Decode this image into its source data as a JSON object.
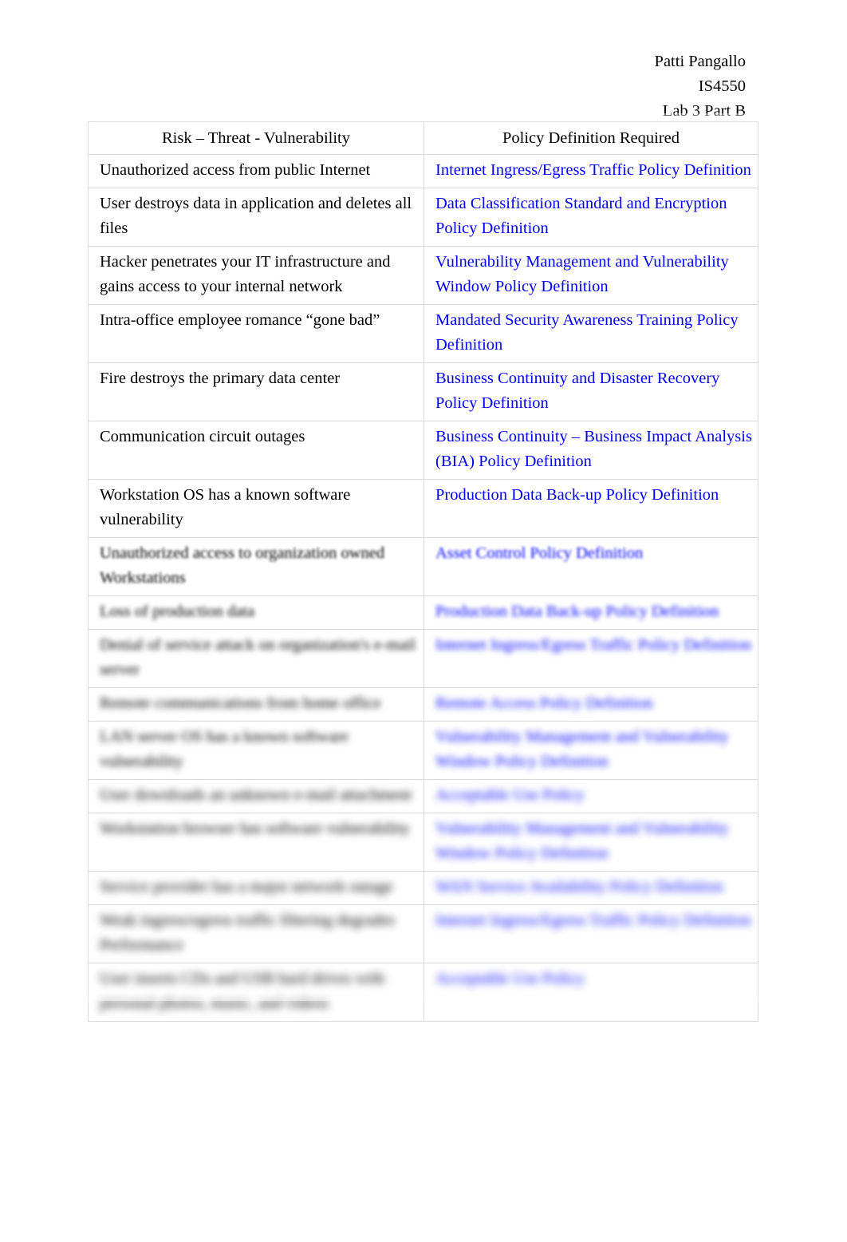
{
  "header": {
    "student_name": "Patti Pangallo",
    "course_code": "IS4550",
    "assignment": "Lab 3 Part B"
  },
  "table": {
    "columns": [
      "Risk – Threat - Vulnerability",
      "Policy Definition Required"
    ],
    "accent_color": "#0000ff",
    "rows": [
      {
        "risk": "Unauthorized access from public Internet",
        "policy": "Internet Ingress/Egress Traffic Policy Definition"
      },
      {
        "risk": "User destroys data in application and deletes all files",
        "policy": "Data Classification Standard and Encryption Policy Definition"
      },
      {
        "risk": "Hacker penetrates your IT infrastructure and gains access to your internal network",
        "policy": "Vulnerability Management and Vulnerability Window Policy Definition"
      },
      {
        "risk": "Intra-office employee romance “gone bad”",
        "policy": "Mandated Security Awareness Training Policy Definition"
      },
      {
        "risk": "Fire destroys the primary data center",
        "policy": "Business Continuity and Disaster Recovery Policy Definition"
      },
      {
        "risk": "Communication circuit outages",
        "policy": "Business Continuity – Business Impact Analysis (BIA) Policy Definition"
      },
      {
        "risk": "Workstation OS has a known software vulnerability",
        "policy": "Production Data Back-up Policy Definition"
      },
      {
        "risk": "Unauthorized access to organization owned Workstations",
        "policy": "Asset Control Policy Definition"
      },
      {
        "risk": "Loss of production data",
        "policy": "Production Data Back-up Policy Definition"
      },
      {
        "risk": "Denial of service attack on organization's e-mail server",
        "policy": "Internet Ingress/Egress Traffic Policy Definition"
      },
      {
        "risk": "Remote communications from home office",
        "policy": "Remote Access Policy Definition"
      },
      {
        "risk": "LAN server OS has a known software vulnerability",
        "policy": "Vulnerability Management and Vulnerability Window Policy Definition"
      },
      {
        "risk": "User downloads an unknown e-mail attachment",
        "policy": "Acceptable Use Policy"
      },
      {
        "risk": "Workstation browser has software vulnerability",
        "policy": "Vulnerability Management and Vulnerability Window Policy Definition"
      },
      {
        "risk": "Service provider has a major network outage",
        "policy": "WAN Service Availability Policy Definition"
      },
      {
        "risk": "Weak ingress/egress traffic filtering degrades Performance",
        "policy": "Internet Ingress/Egress Traffic Policy Definition"
      },
      {
        "risk": "User inserts CDs and USB hard drives with personal photos, music, and videos",
        "policy": "Acceptable Use Policy"
      }
    ]
  }
}
